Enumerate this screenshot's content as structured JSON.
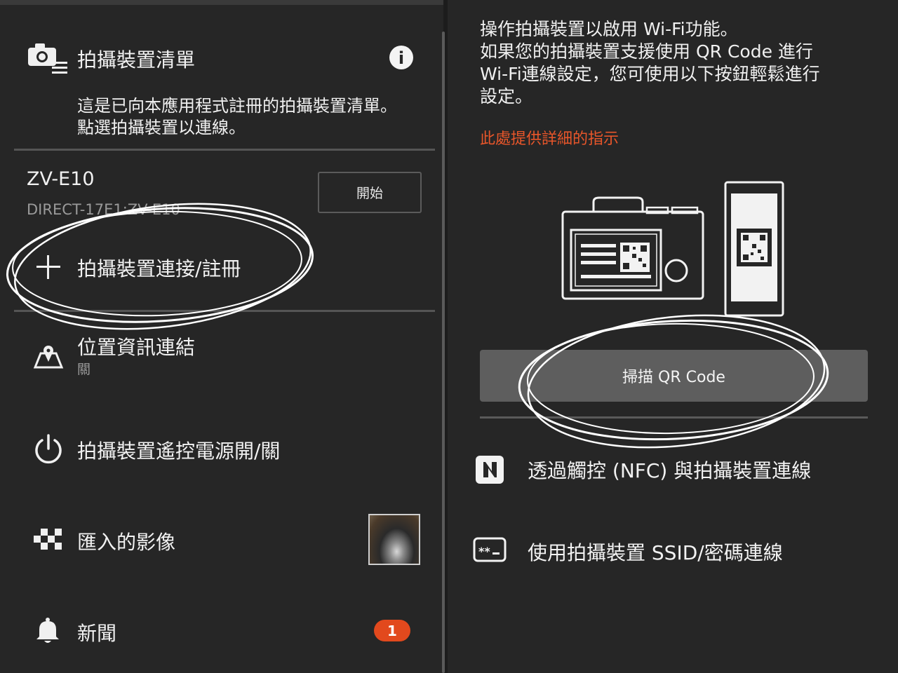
{
  "left": {
    "header": {
      "title": "拍攝裝置清單",
      "description_line1": "這是已向本應用程式註冊的拍攝裝置清單。",
      "description_line2": "點選拍攝裝置以連線。",
      "camera_list_icon": "camera-list-icon",
      "info_icon": "info-icon"
    },
    "device": {
      "name": "ZV-E10",
      "ssid": "DIRECT-17E1:ZV-E10",
      "start_button": "開始"
    },
    "menu": [
      {
        "label": "拍攝裝置連接/註冊",
        "icon": "plus-icon"
      },
      {
        "label": "位置資訊連結",
        "sub": "關",
        "icon": "map-pin-icon"
      },
      {
        "label": "拍攝裝置遙控電源開/關",
        "icon": "power-icon"
      },
      {
        "label": "匯入的影像",
        "icon": "checker-icon"
      },
      {
        "label": "新聞",
        "icon": "bell-icon",
        "badge": "1"
      }
    ]
  },
  "right": {
    "intro_line1": "操作拍攝裝置以啟用 Wi-Fi功能。",
    "intro_line2": "如果您的拍攝裝置支援使用 QR Code 進行",
    "intro_line3": "Wi-Fi連線設定，您可使用以下按鈕輕鬆進行",
    "intro_line4": "設定。",
    "help_link": "此處提供詳細的指示",
    "scan_button": "掃描 QR Code",
    "options": [
      {
        "label": "透過觸控 (NFC) 與拍攝裝置連線",
        "icon": "nfc-icon"
      },
      {
        "label": "使用拍攝裝置 SSID/密碼連線",
        "icon": "password-icon"
      }
    ]
  },
  "colors": {
    "background": "#262626",
    "accent_link": "#e8562a",
    "badge": "#e2491d",
    "button_gray": "#5e5e5e"
  }
}
